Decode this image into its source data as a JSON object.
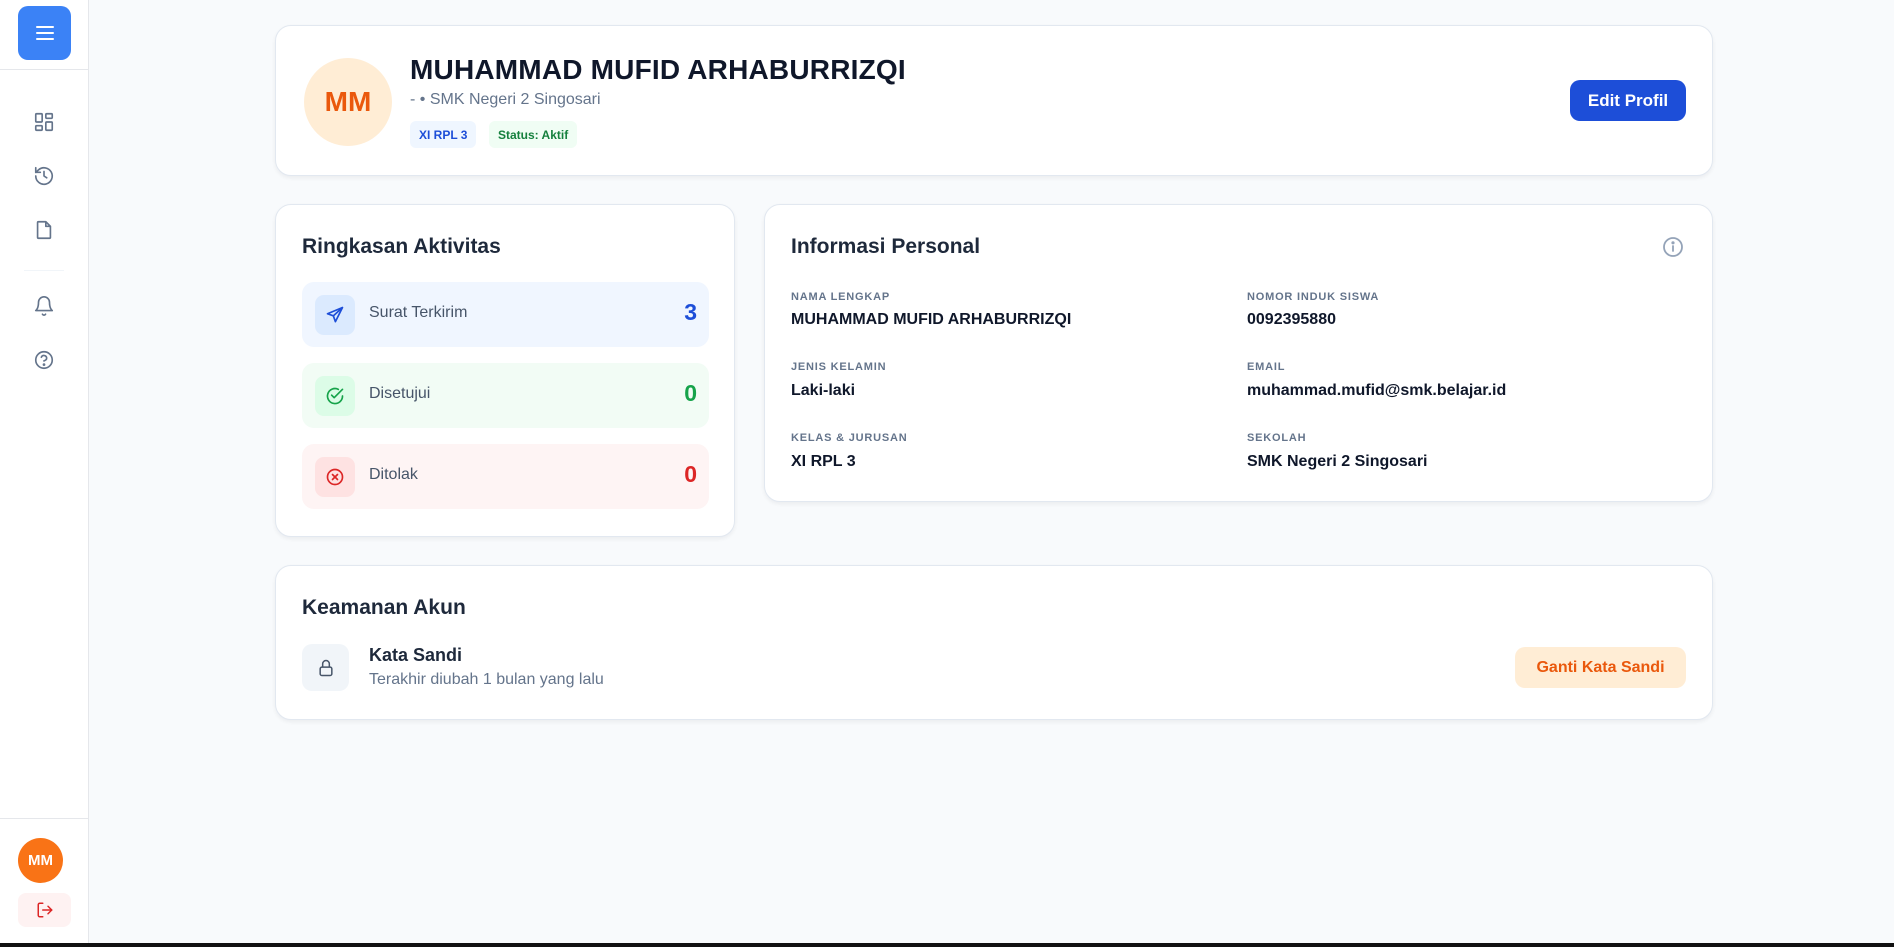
{
  "sidebar": {
    "menu_icon": "hamburger-icon",
    "nav_icons": [
      "dashboard-icon",
      "history-icon",
      "document-icon",
      "bell-icon",
      "help-icon"
    ],
    "user_initials": "MM",
    "logout_icon": "logout-icon"
  },
  "profile": {
    "initials": "MM",
    "name": "MUHAMMAD MUFID ARHABURRIZQI",
    "subtitle": "- • SMK Negeri 2 Singosari",
    "class_badge": "XI RPL 3",
    "status_badge": "Status: Aktif",
    "edit_button": "Edit Profil"
  },
  "activity": {
    "title": "Ringkasan Aktivitas",
    "items": [
      {
        "label": "Surat Terkirim",
        "value": "3",
        "icon": "send-icon",
        "color": "#1d4ed8"
      },
      {
        "label": "Disetujui",
        "value": "0",
        "icon": "check-circle-icon",
        "color": "#16a34a"
      },
      {
        "label": "Ditolak",
        "value": "0",
        "icon": "x-circle-icon",
        "color": "#dc2626"
      }
    ]
  },
  "personal": {
    "title": "Informasi Personal",
    "fields": [
      {
        "label": "NAMA LENGKAP",
        "value": "MUHAMMAD MUFID ARHABURRIZQI"
      },
      {
        "label": "NOMOR INDUK SISWA",
        "value": "0092395880"
      },
      {
        "label": "JENIS KELAMIN",
        "value": "Laki-laki"
      },
      {
        "label": "EMAIL",
        "value": "muhammad.mufid@smk.belajar.id"
      },
      {
        "label": "KELAS & JURUSAN",
        "value": "XI RPL 3"
      },
      {
        "label": "SEKOLAH",
        "value": "SMK Negeri 2 Singosari"
      }
    ]
  },
  "security": {
    "title": "Keamanan Akun",
    "password_title": "Kata Sandi",
    "password_subtitle": "Terakhir diubah 1 bulan yang lalu",
    "change_button": "Ganti Kata Sandi"
  },
  "colors": {
    "primary": "#1d4ed8",
    "accent": "#3b82f6",
    "orange": "#ea580c",
    "success": "#16a34a",
    "danger": "#dc2626"
  }
}
